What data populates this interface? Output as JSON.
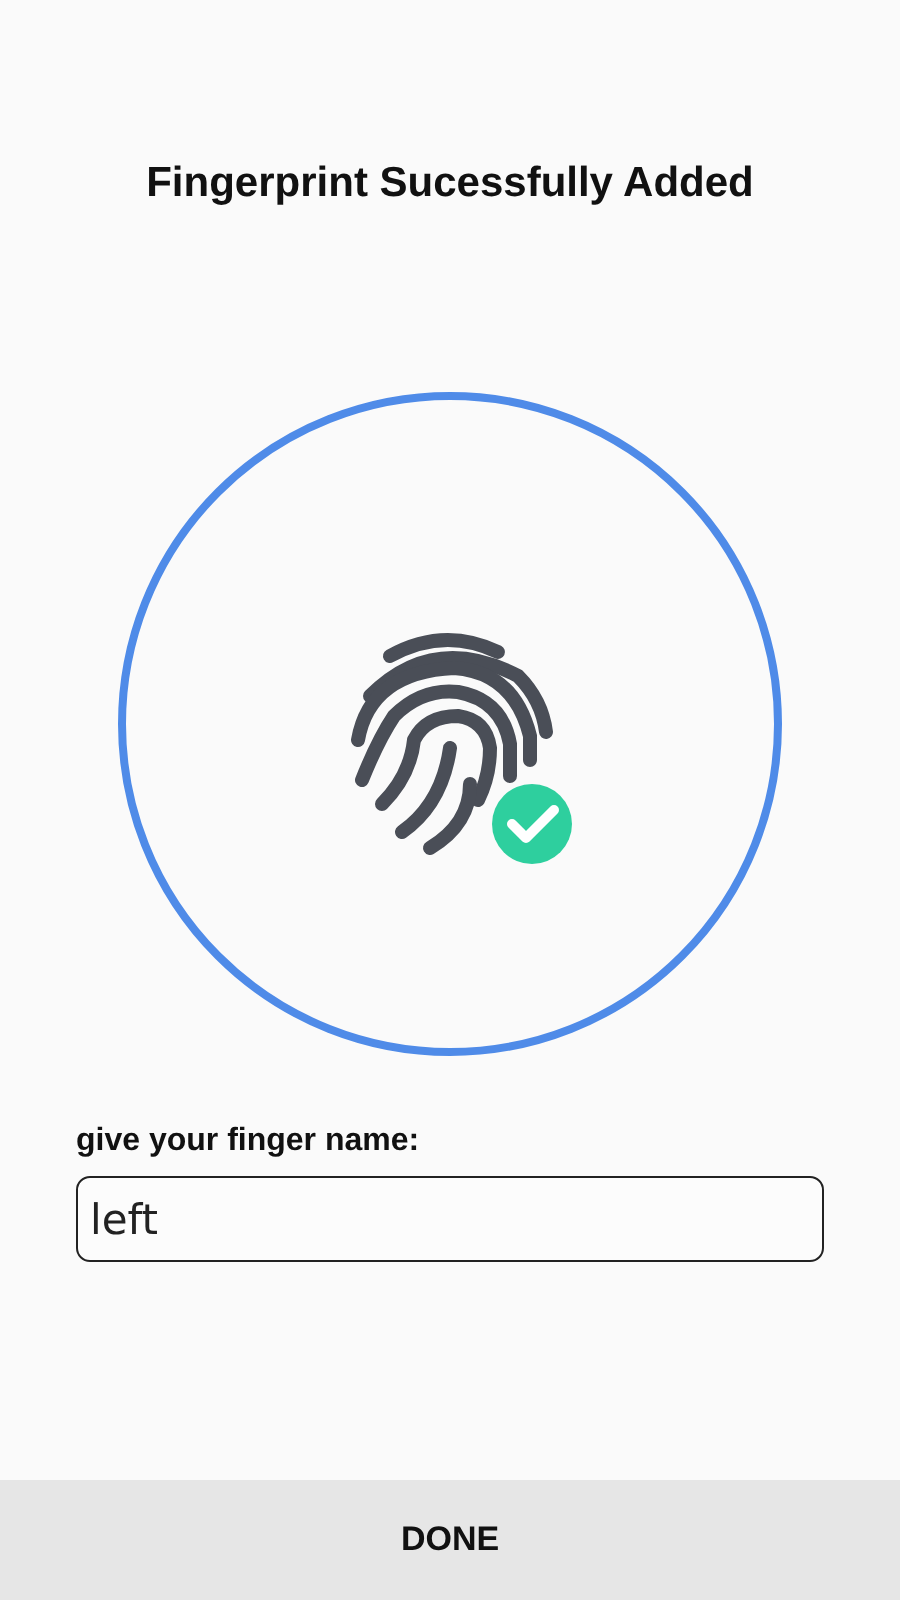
{
  "title": "Fingerprint Sucessfully Added",
  "name_field": {
    "label": "give your finger name:",
    "value": "left"
  },
  "done_button": {
    "label": "DONE"
  }
}
